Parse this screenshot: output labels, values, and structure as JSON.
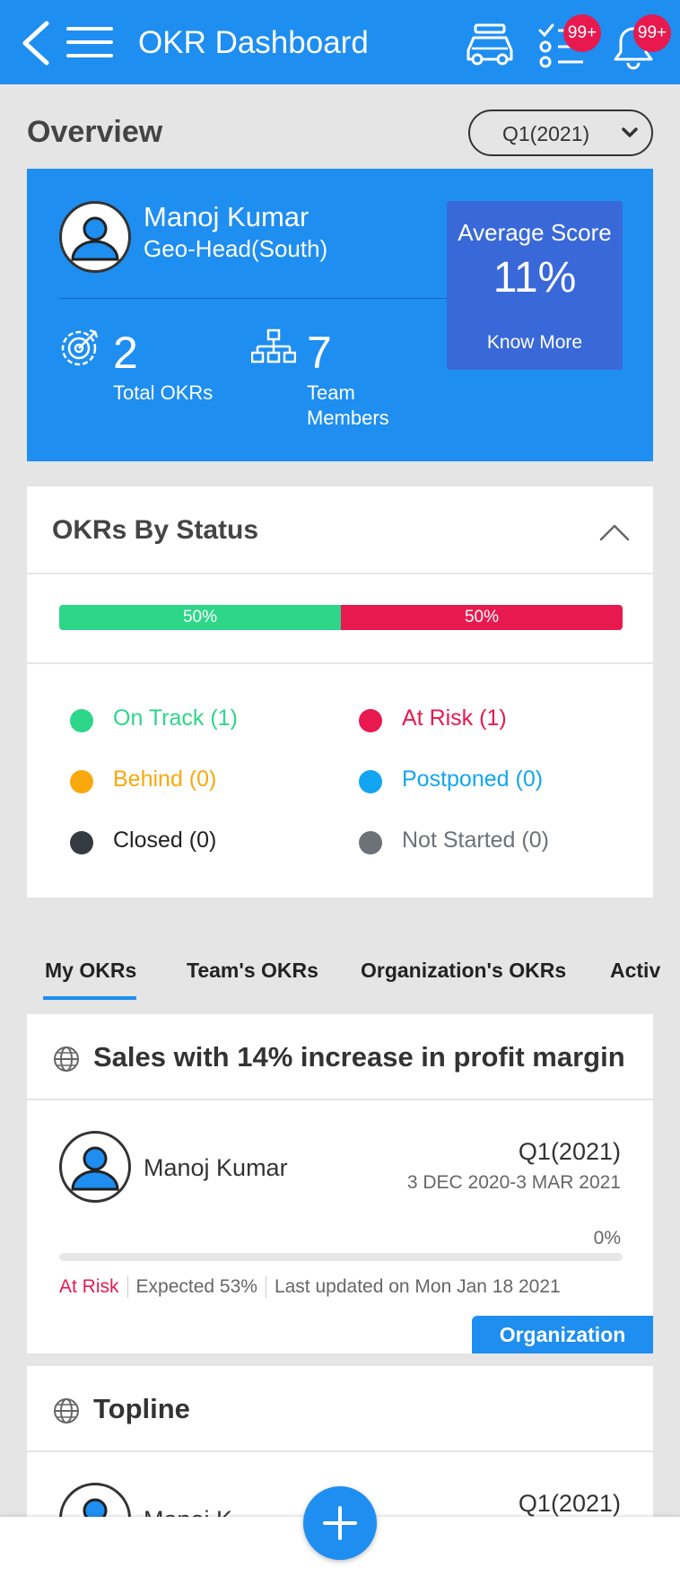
{
  "header": {
    "title": "OKR Dashboard",
    "tasks_badge": "99+",
    "notifications_badge": "99+"
  },
  "overview": {
    "title": "Overview",
    "quarter_selected": "Q1(2021)"
  },
  "profile": {
    "name": "Manoj Kumar",
    "role": "Geo-Head(South)",
    "total_okrs": "2",
    "total_okrs_label": "Total OKRs",
    "team_members": "7",
    "team_members_label": "Team Members"
  },
  "score": {
    "title": "Average Score",
    "value": "11%",
    "link": "Know More"
  },
  "status": {
    "title": "OKRs By Status",
    "bar": [
      {
        "label": "50%",
        "fraction": 0.5,
        "color": "#2ed68a"
      },
      {
        "label": "50%",
        "fraction": 0.5,
        "color": "#e8194f"
      }
    ],
    "legend": [
      {
        "label": "On Track (1)",
        "color": "#2ed68a"
      },
      {
        "label": "At Risk (1)",
        "color": "#e8194f"
      },
      {
        "label": "Behind (0)",
        "color": "#f9a80e"
      },
      {
        "label": "Postponed (0)",
        "color": "#12a5f2"
      },
      {
        "label": "Closed (0)",
        "color": "#333a40"
      },
      {
        "label": "Not Started (0)",
        "color": "#6c7278"
      }
    ]
  },
  "tabs": [
    "My OKRs",
    "Team's OKRs",
    "Organization's OKRs",
    "Activ"
  ],
  "okrs": [
    {
      "title": "Sales with 14% increase in profit margin",
      "owner": "Manoj Kumar",
      "quarter": "Q1(2021)",
      "dates": "3 DEC 2020-3 MAR 2021",
      "progress_label": "0%",
      "progress": 0,
      "status": "At Risk",
      "expected": "Expected 53%",
      "updated": "Last updated on Mon Jan 18 2021",
      "scope": "Organization"
    },
    {
      "title": "Topline",
      "owner": "Manoj K",
      "quarter": "Q1(2021)"
    }
  ],
  "colors": {
    "primary": "#1e8ef0",
    "score_box": "#3968d8",
    "badge": "#e8194f"
  },
  "icons": [
    "back-arrow-icon",
    "hamburger-menu-icon",
    "car-icon",
    "task-list-icon",
    "bell-icon",
    "target-icon",
    "org-chart-icon",
    "chevron-up-icon",
    "globe-icon",
    "user-avatar-icon",
    "plus-icon",
    "chevron-down-icon"
  ]
}
